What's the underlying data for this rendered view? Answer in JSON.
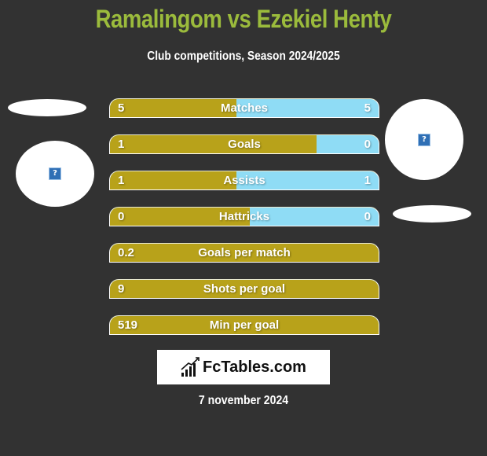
{
  "header": {
    "title": "Ramalingom vs Ezekiel Henty",
    "subtitle": "Club competitions, Season 2024/2025"
  },
  "players": {
    "left": {
      "avatar_icon": "broken-image-icon",
      "avatar_glyph": "?"
    },
    "right": {
      "avatar_icon": "broken-image-icon",
      "avatar_glyph": "?"
    }
  },
  "colors": {
    "left": "#b8a21a",
    "right": "#8fdcf5",
    "title": "#9bbb3c",
    "background": "#323232"
  },
  "stats": [
    {
      "label": "Matches",
      "left": "5",
      "right": "5",
      "left_share": 0.47
    },
    {
      "label": "Goals",
      "left": "1",
      "right": "0",
      "left_share": 0.77
    },
    {
      "label": "Assists",
      "left": "1",
      "right": "1",
      "left_share": 0.47
    },
    {
      "label": "Hattricks",
      "left": "0",
      "right": "0",
      "left_share": 0.52
    },
    {
      "label": "Goals per match",
      "left": "0.2",
      "right": "",
      "left_share": 1.0
    },
    {
      "label": "Shots per goal",
      "left": "9",
      "right": "",
      "left_share": 1.0
    },
    {
      "label": "Min per goal",
      "left": "519",
      "right": "",
      "left_share": 1.0
    }
  ],
  "footer": {
    "logo_text": "FcTables.com",
    "logo_icon": "bar-chart-icon",
    "date": "7 november 2024"
  }
}
